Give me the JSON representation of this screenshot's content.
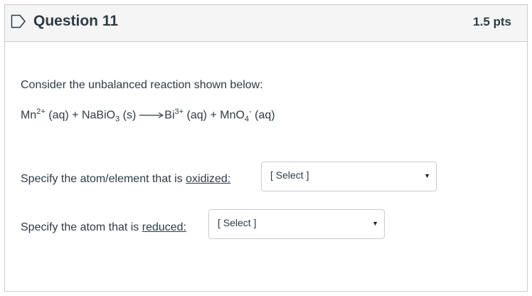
{
  "question": {
    "title": "Question 11",
    "points": "1.5 pts",
    "prompt": "Consider the unbalanced reaction shown below:",
    "equation": {
      "r1": "Mn",
      "r1_charge": "2+",
      "r1_state": "(aq)",
      "plus1": "+",
      "r2": "NaBiO",
      "r2_sub": "3",
      "r2_state": "(s)",
      "p1": "Bi",
      "p1_charge": "3+",
      "p1_state": "(aq)",
      "plus2": "+",
      "p2": "MnO",
      "p2_sub": "4",
      "p2_charge": "-",
      "p2_state": "(aq)"
    },
    "q1": {
      "text": "Specify the atom/element that is ",
      "keyword": "oxidized:",
      "select": "[ Select ]"
    },
    "q2": {
      "text": "Specify the atom that is ",
      "keyword": "reduced:",
      "select": "[ Select ]"
    }
  },
  "icons": {
    "flag": "flag-outline-icon",
    "caret": "caret-down-icon"
  }
}
